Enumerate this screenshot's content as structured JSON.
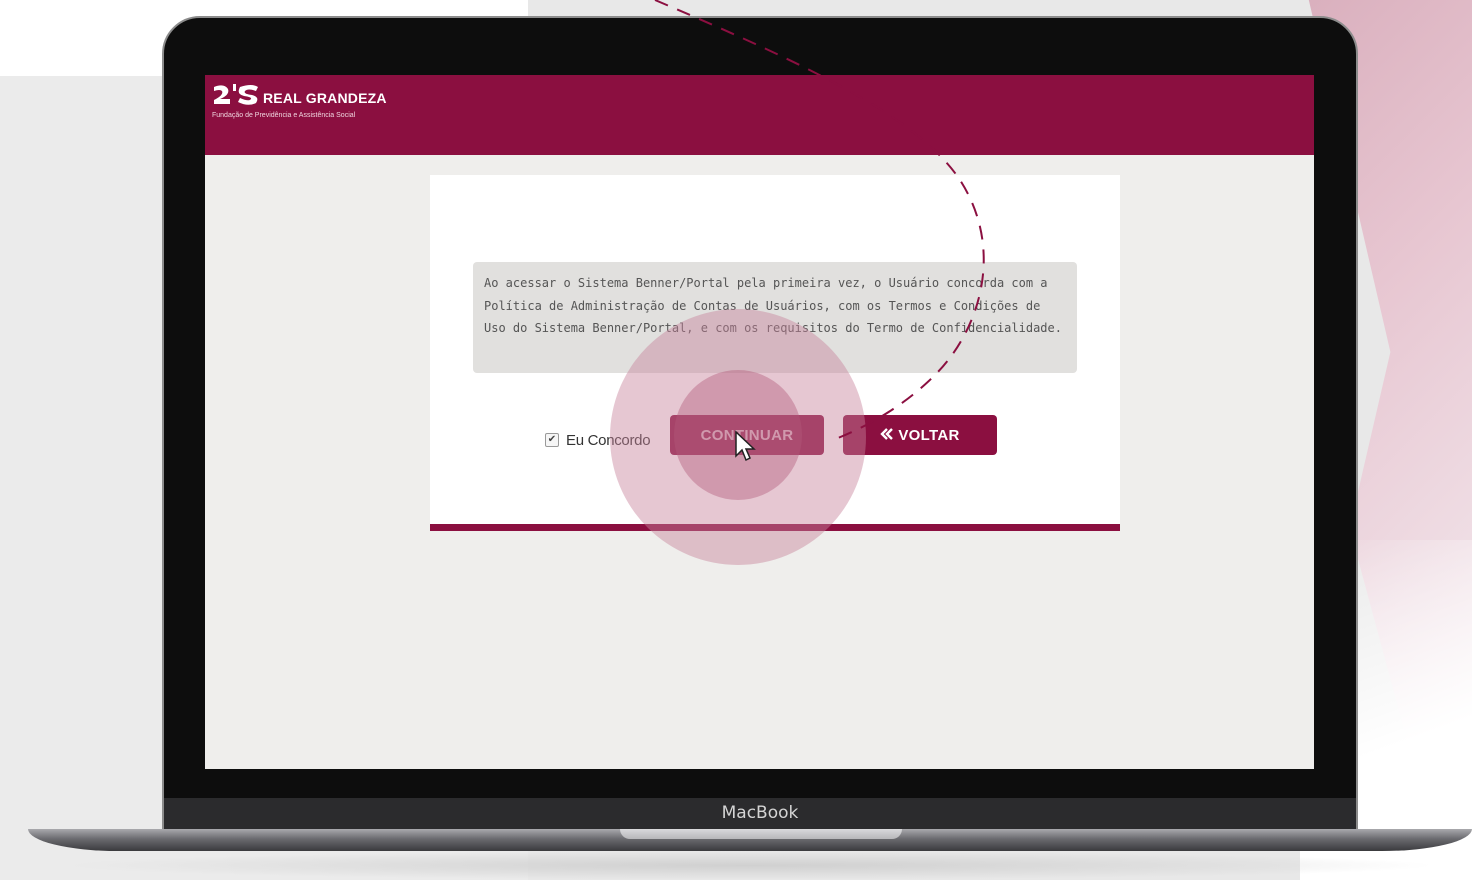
{
  "brand": {
    "name": "REAL GRANDEZA",
    "tagline": "Fundação de Previdência e Assistência Social",
    "color": "#8b0f40"
  },
  "terms": {
    "text": "Ao acessar o Sistema Benner/Portal pela primeira vez, o Usuário concorda com a Política de Administração de Contas de Usuários, com os Termos e Condições de Uso do Sistema Benner/Portal, e com os requisitos do Termo de Confidencialidade."
  },
  "agree": {
    "label": "Eu Concordo",
    "checked": true
  },
  "buttons": {
    "continue_label": "CONTINUAR",
    "back_label": "VOLTAR",
    "back_icon": "double-chevron-left-icon"
  },
  "device": {
    "label": "MacBook"
  }
}
